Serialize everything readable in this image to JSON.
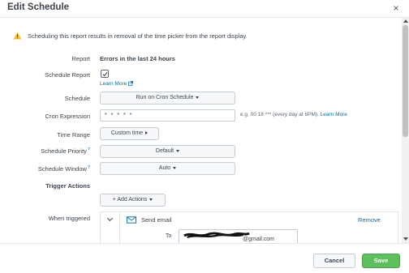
{
  "dialog": {
    "title": "Edit Schedule",
    "close_glyph": "×"
  },
  "warning": {
    "icon": "warning-triangle-icon",
    "icon_color": "#f8be34",
    "text": "Scheduling this report results in removal of the time picker from the report display."
  },
  "form": {
    "report": {
      "label": "Report",
      "value": "Errors in the last 24 hours"
    },
    "schedule_report": {
      "label": "Schedule Report",
      "checked": true,
      "learn_more": "Learn More"
    },
    "schedule": {
      "label": "Schedule",
      "value": "Run on Cron Schedule"
    },
    "cron_expression": {
      "label": "Cron Expression",
      "value": "* * * * *",
      "hint": "e.g. 00 18 *** (every day at 6PM).",
      "learn_more": "Learn More"
    },
    "time_range": {
      "label": "Time Range",
      "value": "Custom time"
    },
    "schedule_priority": {
      "label": "Schedule Priority",
      "help_mark": "?",
      "value": "Default"
    },
    "schedule_window": {
      "label": "Schedule Window",
      "help_mark": "?",
      "value": "Auto"
    },
    "trigger_actions": {
      "label": "Trigger Actions",
      "add_actions": "+ Add Actions"
    },
    "when_triggered": {
      "label": "When triggered",
      "action_name": "Send email",
      "remove": "Remove",
      "to_label": "To",
      "to_value": "@gmail.com"
    }
  },
  "footer": {
    "cancel": "Cancel",
    "save": "Save"
  },
  "colors": {
    "link": "#006eaa",
    "save_button": "#5cc05c",
    "text": "#3c444d"
  }
}
